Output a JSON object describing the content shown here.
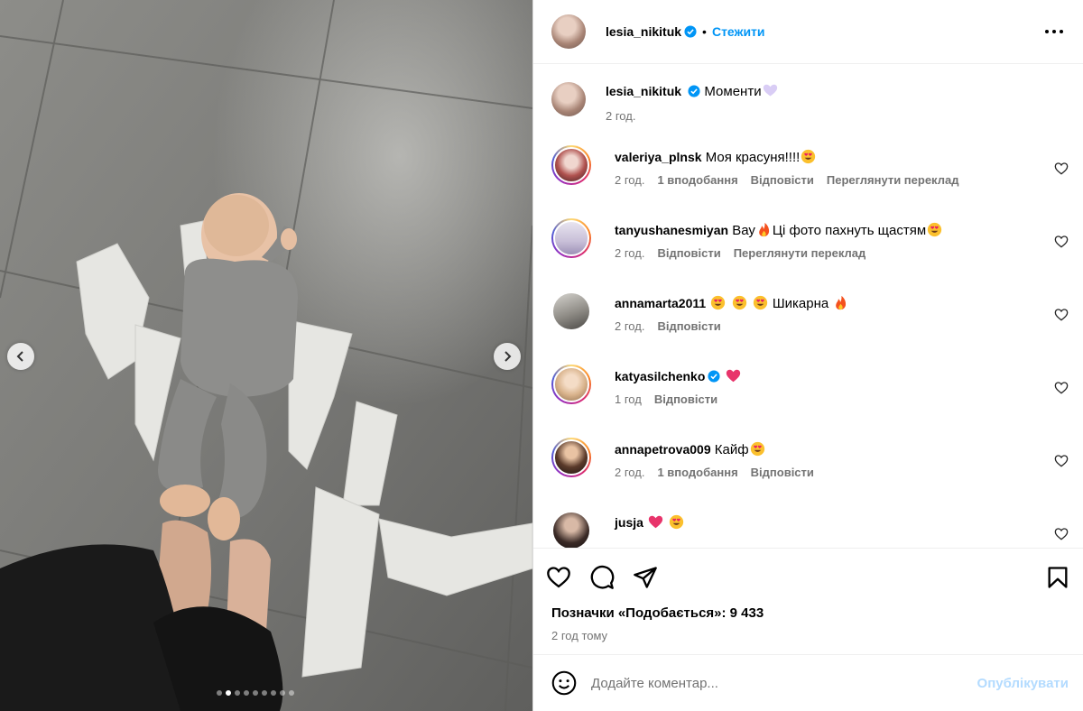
{
  "post": {
    "author": "lesia_nikituk",
    "follow_label": "Стежити",
    "separator": "•",
    "caption": "Моменти",
    "caption_time": "2 год.",
    "likes_label": "Позначки «Подобається»: 9 433",
    "posted_ago": "2 год тому",
    "carousel": {
      "total": 9,
      "active_index": 1
    }
  },
  "comments": [
    {
      "user": "valeriya_plnsk",
      "text": "Моя красуня!!!!",
      "emoji": [
        "heart-eyes"
      ],
      "time": "2 год.",
      "likes": "1 вподобання",
      "reply": "Відповісти",
      "translate": "Переглянути переклад",
      "verified": false,
      "story_ring": true
    },
    {
      "user": "tanyushanesmiyan",
      "text_before": "Вау",
      "text": "Ці фото пахнуть щастям",
      "emoji": [
        "heart-eyes"
      ],
      "time": "2 год.",
      "reply": "Відповісти",
      "translate": "Переглянути переклад",
      "verified": false,
      "story_ring": true
    },
    {
      "user": "annamarta2011",
      "text": "Шикарна",
      "emoji": [
        "heart-eyes",
        "heart-eyes",
        "heart-eyes",
        "fire"
      ],
      "time": "2 год.",
      "reply": "Відповісти",
      "verified": false,
      "story_ring": false
    },
    {
      "user": "katyasilchenko",
      "text": "",
      "emoji": [
        "pink-heart"
      ],
      "time": "1 год",
      "reply": "Відповісти",
      "verified": true,
      "story_ring": true
    },
    {
      "user": "annapetrova009",
      "text": "Кайф",
      "emoji": [
        "heart-eyes"
      ],
      "time": "2 год.",
      "likes": "1 вподобання",
      "reply": "Відповісти",
      "verified": false,
      "story_ring": true
    },
    {
      "user": "jusja",
      "text": "",
      "emoji": [
        "pink-heart",
        "heart-eyes"
      ],
      "verified": false,
      "story_ring": false
    }
  ],
  "composer": {
    "placeholder": "Додайте коментар...",
    "post_label": "Опублікувати"
  },
  "icons": {
    "options": "more-horizontal-icon",
    "like": "heart-outline-icon",
    "comment": "comment-bubble-icon",
    "share": "paper-plane-icon",
    "save": "bookmark-icon",
    "emoji": "smiley-icon"
  },
  "colors": {
    "accent": "#0095f6",
    "secondary_text": "#737373",
    "disabled_button": "#b3dbff",
    "verified": "#0095f6"
  }
}
